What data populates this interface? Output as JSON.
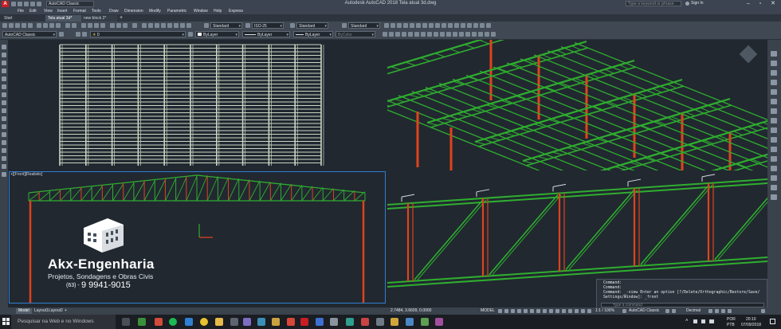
{
  "window": {
    "title": "Autodesk AutoCAD 2018   Tela atual 3d.dwg",
    "search_placeholder": "Type a keyword or phrase",
    "user": "Sign In",
    "quick_access_workspace": "AutoCAD Classic"
  },
  "menu": [
    "File",
    "Edit",
    "View",
    "Insert",
    "Format",
    "Tools",
    "Draw",
    "Dimension",
    "Modify",
    "Parametric",
    "Window",
    "Help",
    "Express"
  ],
  "doc_tabs": [
    {
      "label": "Start",
      "active": false
    },
    {
      "label": "Tela atual 3d*",
      "active": true
    },
    {
      "label": "new block 2*",
      "active": false
    }
  ],
  "toolbars": {
    "text_style": "Standard",
    "dim_style": "ISO-25",
    "table_style": "Standard",
    "multileader_style": "Standard",
    "workspace": "AutoCAD Classic",
    "layer": "0",
    "color": "ByLayer",
    "linetype": "ByLayer",
    "lineweight": "ByLayer",
    "plot_style": "ByColor"
  },
  "viewport_label": "+][Front][Realistic]",
  "logo": {
    "name": "Akx-Engenharia",
    "tagline": "Projetos, Sondagens e Obras Civis",
    "phone_prefix": "(63) -",
    "phone": "9 9941-9015"
  },
  "command_window": {
    "lines": [
      "Command:",
      "Command:",
      "Command:  _-view Enter an option [?/Delete/Orthographic/Restore/Save/",
      "Settings/Window]: _front"
    ],
    "input_placeholder": "Type a command"
  },
  "layout_tabs": [
    {
      "label": "Model",
      "active": true
    },
    {
      "label": "Layout1",
      "active": false
    },
    {
      "label": "Layout2",
      "active": false
    }
  ],
  "status": {
    "coords": "2.7484, 3.6609, 0.0000",
    "model": "MODEL",
    "scale": "1:1 / 100%",
    "workspace": "AutoCAD Classic",
    "units": "Decimal"
  },
  "taskbar": {
    "search_placeholder": "Pesquisar na Web e no Windows",
    "lang": "POR",
    "layout": "PTB",
    "time": "20:10",
    "date": "07/09/2018"
  },
  "colors": {
    "truss_green": "#2fae2f",
    "column_red": "#e0431b",
    "model_bg": "#212830",
    "active_border": "#2f7fd3"
  }
}
